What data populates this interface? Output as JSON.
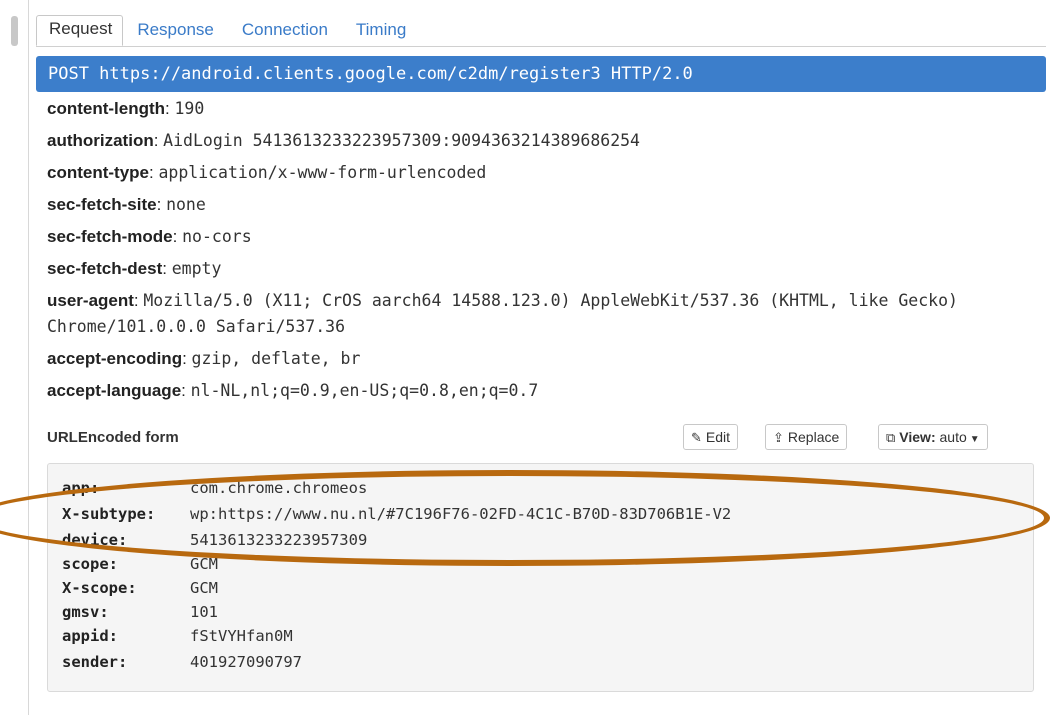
{
  "tabs": [
    {
      "label": "Request",
      "active": true
    },
    {
      "label": "Response",
      "active": false
    },
    {
      "label": "Connection",
      "active": false
    },
    {
      "label": "Timing",
      "active": false
    }
  ],
  "request_line": "POST https://android.clients.google.com/c2dm/register3 HTTP/2.0",
  "headers": [
    {
      "key": "content-length",
      "value": "190"
    },
    {
      "key": "authorization",
      "value": "AidLogin 5413613233223957309:9094363214389686254"
    },
    {
      "key": "content-type",
      "value": "application/x-www-form-urlencoded"
    },
    {
      "key": "sec-fetch-site",
      "value": "none"
    },
    {
      "key": "sec-fetch-mode",
      "value": "no-cors"
    },
    {
      "key": "sec-fetch-dest",
      "value": "empty"
    },
    {
      "key": "user-agent",
      "value": "Mozilla/5.0 (X11; CrOS aarch64 14588.123.0) AppleWebKit/537.36 (KHTML, like Gecko) Chrome/101.0.0.0 Safari/537.36"
    },
    {
      "key": "accept-encoding",
      "value": "gzip, deflate, br"
    },
    {
      "key": "accept-language",
      "value": "nl-NL,nl;q=0.9,en-US;q=0.8,en;q=0.7"
    }
  ],
  "form": {
    "title": "URLEncoded form",
    "edit_label": "Edit",
    "replace_label": "Replace",
    "view_label": "View:",
    "view_value": "auto",
    "rows": [
      {
        "key": "app:",
        "value": "com.chrome.chromeos"
      },
      {
        "key": "X-subtype:",
        "value": "wp:https://www.nu.nl/#7C196F76-02FD-4C1C-B70D-83D706B1E-V2"
      },
      {
        "key": "device:",
        "value": "5413613233223957309"
      },
      {
        "key": "scope:",
        "value": "GCM"
      },
      {
        "key": "X-scope:",
        "value": "GCM"
      },
      {
        "key": "gmsv:",
        "value": "101"
      },
      {
        "key": "appid:",
        "value": "fStVYHfan0M"
      },
      {
        "key": "sender:",
        "value": "401927090797"
      }
    ]
  },
  "icons": {
    "edit": "edit-icon",
    "replace": "upload-icon",
    "view": "copy-icon",
    "caret": "caret-down-icon"
  },
  "colors": {
    "accent": "#3c7ecb",
    "tab_link": "#3a7bc8",
    "annotation": "#b8690f"
  }
}
